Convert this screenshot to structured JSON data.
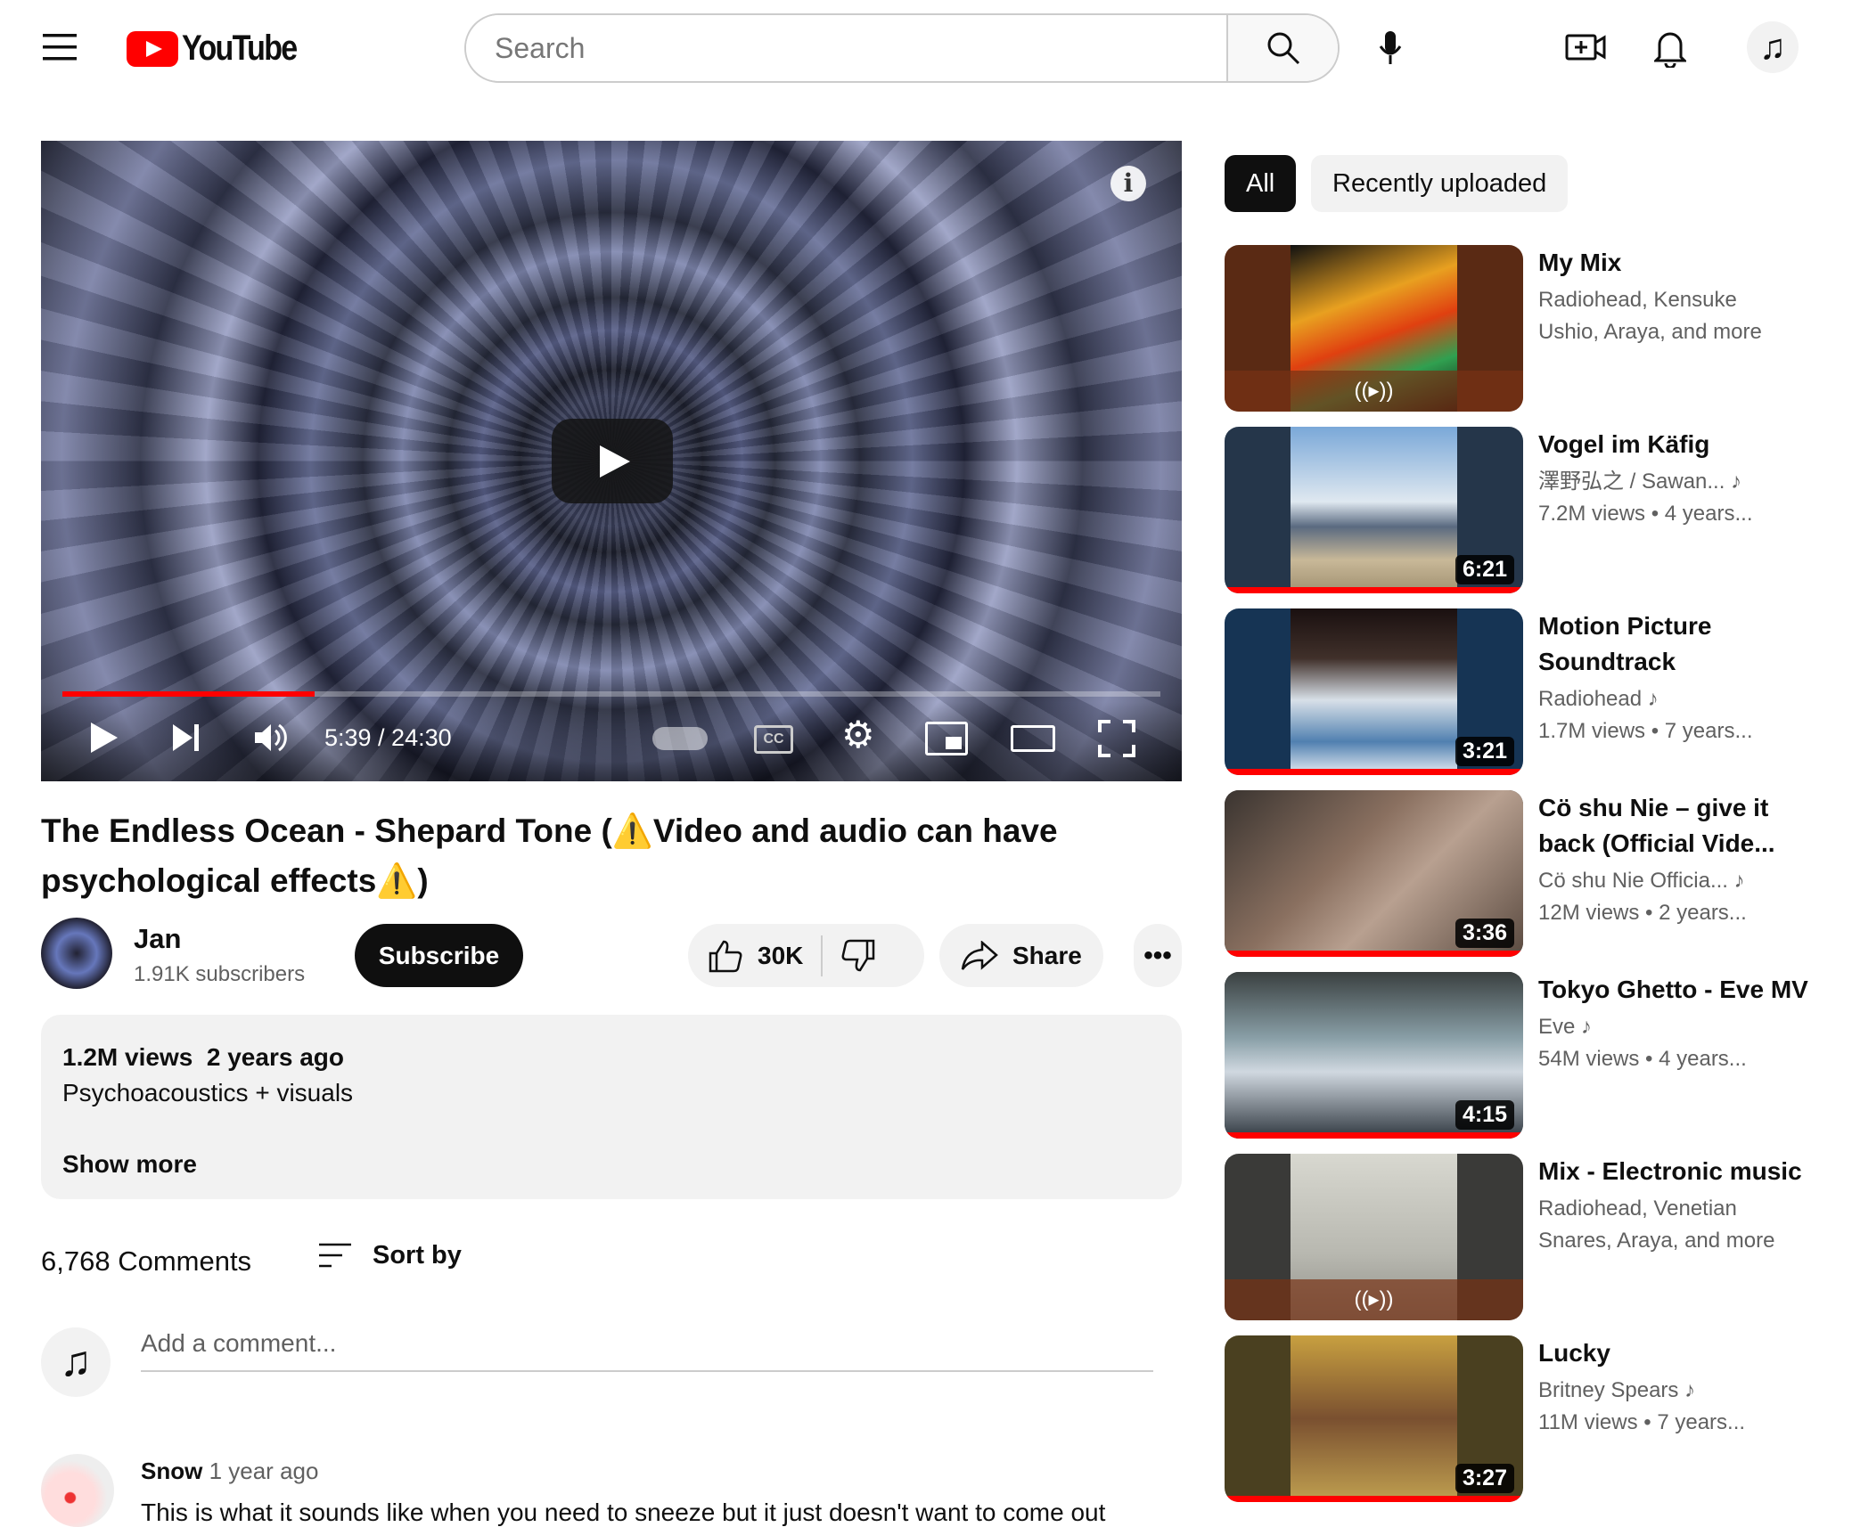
{
  "header": {
    "logo_text": "YouTube",
    "search_placeholder": "Search"
  },
  "player": {
    "time": "5:39 / 24:30",
    "progress": 0.23,
    "info": "i"
  },
  "video": {
    "title": "The Endless Ocean - Shepard Tone (⚠️Video and audio can have psychological effects⚠️)",
    "channel": "Jan",
    "subscribers": "1.91K subscribers",
    "subscribe": "Subscribe",
    "likes": "30K",
    "share": "Share",
    "views": "1.2M views",
    "age": "2 years ago",
    "description": "Psychoacoustics + visuals",
    "show_more": "Show more"
  },
  "comments": {
    "count": "6,768 Comments",
    "sort": "Sort by",
    "add_placeholder": "Add a comment...",
    "first": {
      "author": "Snow",
      "age": "1 year ago",
      "text": "This is what it sounds like when you need to sneeze but it just doesn't want to come out"
    }
  },
  "chips": [
    "All",
    "Recently uploaded"
  ],
  "related": [
    {
      "title": "My Mix",
      "line1": "Radiohead, Kensuke",
      "line2": "Ushio, Araya, and more",
      "duration": "",
      "mix": true,
      "bg": "#5a2a14",
      "art": "linear-gradient(160deg,#111 0,#e8a020 35%,#e04010 55%,#30a050 75%,#101010)"
    },
    {
      "title": "Vogel im Käfig",
      "line1": "澤野弘之 / Sawan...",
      "line2": "7.2M views  • 4 years...",
      "duration": "6:21",
      "bg": "#25364a",
      "art": "linear-gradient(#7aa8d8 0,#dfe8f0 45%,#5a6a80 60%,#c8b898 80%,#a09070)"
    },
    {
      "title": "Motion Picture Soundtrack",
      "line1": "Radiohead",
      "line2": "1.7M views  • 7 years...",
      "duration": "3:21",
      "bg": "#163454",
      "art": "linear-gradient(#1a1010 0,#40302a 30%,#d8e0e8 55%,#5080b0 80%,#e8eef4)"
    },
    {
      "title": "Cö shu Nie – give it back (Official Vide...",
      "line1": "Cö shu Nie Officia...",
      "line2": "12M views  • 2 years...",
      "duration": "3:36",
      "bg": "#2a2522",
      "art": "linear-gradient(135deg,#3a3430,#8a7060 40%,#b8a090 60%,#5a4a40)",
      "wide": true
    },
    {
      "title": "Tokyo Ghetto - Eve MV",
      "line1": "Eve",
      "line2": "54M views  • 4 years...",
      "duration": "4:15",
      "bg": "#2a2e30",
      "art": "linear-gradient(#3a4040,#8aa0a8 40%,#d0d8e0 60%,#303840)",
      "wide": true
    },
    {
      "title": "Mix - Electronic music",
      "line1": "Radiohead, Venetian",
      "line2": "Snares, Araya, and more",
      "duration": "",
      "mix": true,
      "bg": "#3a3a38",
      "art": "linear-gradient(#d8d8d0,#b8b8b0 60%,#908f88)"
    },
    {
      "title": "Lucky",
      "line1": "Britney Spears",
      "line2": "11M views  • 7 years...",
      "duration": "3:27",
      "bg": "#4a4020",
      "art": "linear-gradient(#c8a040,#7a5030 50%,#c0a050)"
    }
  ]
}
